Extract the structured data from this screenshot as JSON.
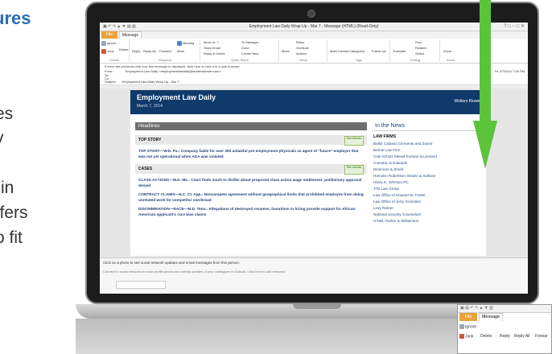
{
  "side": {
    "heading": "ures",
    "lines": [
      "es",
      "y",
      "-in",
      "ffers",
      "o fit"
    ]
  },
  "window": {
    "title": "Employment Law Daily Wrap Up - Mar 7  -  Message (HTML) (Read-Only)",
    "qat": "▣ ↶ ↷ ▲ ▼ ▤ ▥",
    "controls": "?  □  −  □  ✕"
  },
  "tabs": {
    "file": "File",
    "message": "Message"
  },
  "ribbon": {
    "delete_group": {
      "ignore": "Ignore",
      "junk": "Junk",
      "delete": "Delete",
      "label": "Delete"
    },
    "respond_group": {
      "reply": "Reply",
      "reply_all": "Reply All",
      "forward": "Forward",
      "meeting": "Meeting",
      "more": "More",
      "label": "Respond"
    },
    "quick_steps": {
      "move_to": "Move to: ?",
      "team_email": "Team Email",
      "reply_delete": "Reply & Delete",
      "to_manager": "To Manager",
      "done": "Done",
      "create_new": "Create New",
      "label": "Quick Steps"
    },
    "move_group": {
      "move": "Move",
      "rules": "Rules",
      "onenote": "OneNote",
      "actions": "Actions",
      "label": "Move"
    },
    "tags_group": {
      "mark_unread": "Mark Unread",
      "categorize": "Categorize",
      "follow_up": "Follow Up",
      "label": "Tags"
    },
    "editing_group": {
      "translate": "Translate",
      "find": "Find",
      "related": "Related",
      "select": "Select",
      "label": "Editing"
    },
    "zoom_group": {
      "zoom": "Zoom",
      "label": "Zoom"
    }
  },
  "header": {
    "notice": "If there are problems with how this message is displayed, click here to view it in a web browser.",
    "from_label": "From:",
    "from_value": "Employment Law Daily <employmentlawdaily@wolterskluwer.com>",
    "to_label": "To:",
    "cc_label": "Cc:",
    "subject_label": "Subject:",
    "subject_value": "Employment Law Daily Wrap Up - Mar 7",
    "sent": "Fri 3/7/2014 7:30 PM"
  },
  "newsletter": {
    "title": "Employment Law Daily",
    "date": "March 7, 2014",
    "logo": "Wolters Kluwer",
    "headlines_label": "Headlines",
    "top_story_label": "TOP STORY",
    "see_articles": "See Articles",
    "top_story": "TOP STORY—W.D. Pa.: Company liable for over 300 unlawful pre-employment physicals as agent of “future” employer that was not yet operational when ADA was violated",
    "cases_label": "CASES",
    "cases": [
      "CLASS ACTIONS—W.D. Mo.: Court finds much to dislike about proposed class action wage settlement; preliminary approval denied",
      "CONTRACT CLAIMS—N.C. Ct. App.: Noncompete agreement without geographical limits that prohibited employee from doing unrelated work for competitor overbroad",
      "DISCRIMINATION—RACE—M.D. Tenn.: Allegations of destroyed resumes, favoritism in hiring provide support for African-American applicant’s race bias claims"
    ],
    "in_the_news_label": "In the News",
    "law_firms_label": "LAW FIRMS",
    "law_firms": [
      "Ballot Cafasso Clements and Zonnir",
      "Bernie Law Firm",
      "Cole Schotz Meisel Forman & Leonard",
      "Cranston & Edwards",
      "Dinsmore & Shohl",
      "Herndon Robertson Strawn & Sullivan",
      "Hilary K. Johnson PC",
      "JTB Law Group",
      "Law Office of Howard W. Foster",
      "Law Office of Jerry Gonzalez",
      "Levy Ratner",
      "National Security Counselors",
      "O'Neil, Parker & Williamson"
    ]
  },
  "social": {
    "line1": "Click on a photo to see social network updates and email messages from this person.",
    "line2": "Connect to social networks to show profile photos and activity updates of your colleagues in Outlook. Click here to add networks."
  },
  "zoom_inset": {
    "qat": "▣ ▤ ↶ ↷ ▲ ▼ ▥",
    "file": "File",
    "message": "Message",
    "ignore": "Ignore",
    "junk": "Junk",
    "delete": "Delete",
    "reply": "Reply",
    "reply_all": "Reply All",
    "forward": "Forwar"
  },
  "colors": {
    "accent": "#e8a33a",
    "banner": "#0f3a6a",
    "heading_blue": "#2a6bb5",
    "arrow_green": "#5cc43a"
  }
}
